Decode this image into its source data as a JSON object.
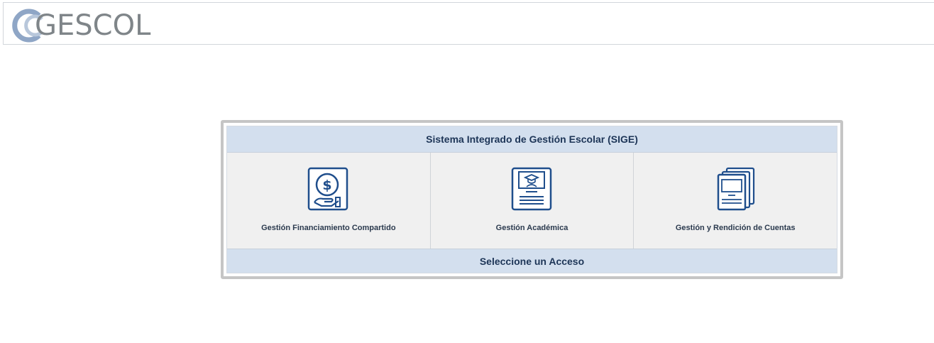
{
  "header": {
    "logo_text": "GESCOL"
  },
  "panel": {
    "title": "Sistema Integrado de Gestión Escolar (SIGE)",
    "footer": "Seleccione un Acceso",
    "options": [
      {
        "label": "Gestión Financiamiento Compartido",
        "icon": "money-hand-icon"
      },
      {
        "label": "Gestión Académica",
        "icon": "graduate-certificate-icon"
      },
      {
        "label": "Gestión y Rendición de Cuentas",
        "icon": "stacked-documents-icon"
      }
    ]
  },
  "colors": {
    "header_bar": "#d3dfee",
    "icon_blue": "#1f4e8c",
    "title_text": "#1d3557",
    "logo_gray": "#7f8589",
    "logo_blue": "#9fb3cf"
  }
}
